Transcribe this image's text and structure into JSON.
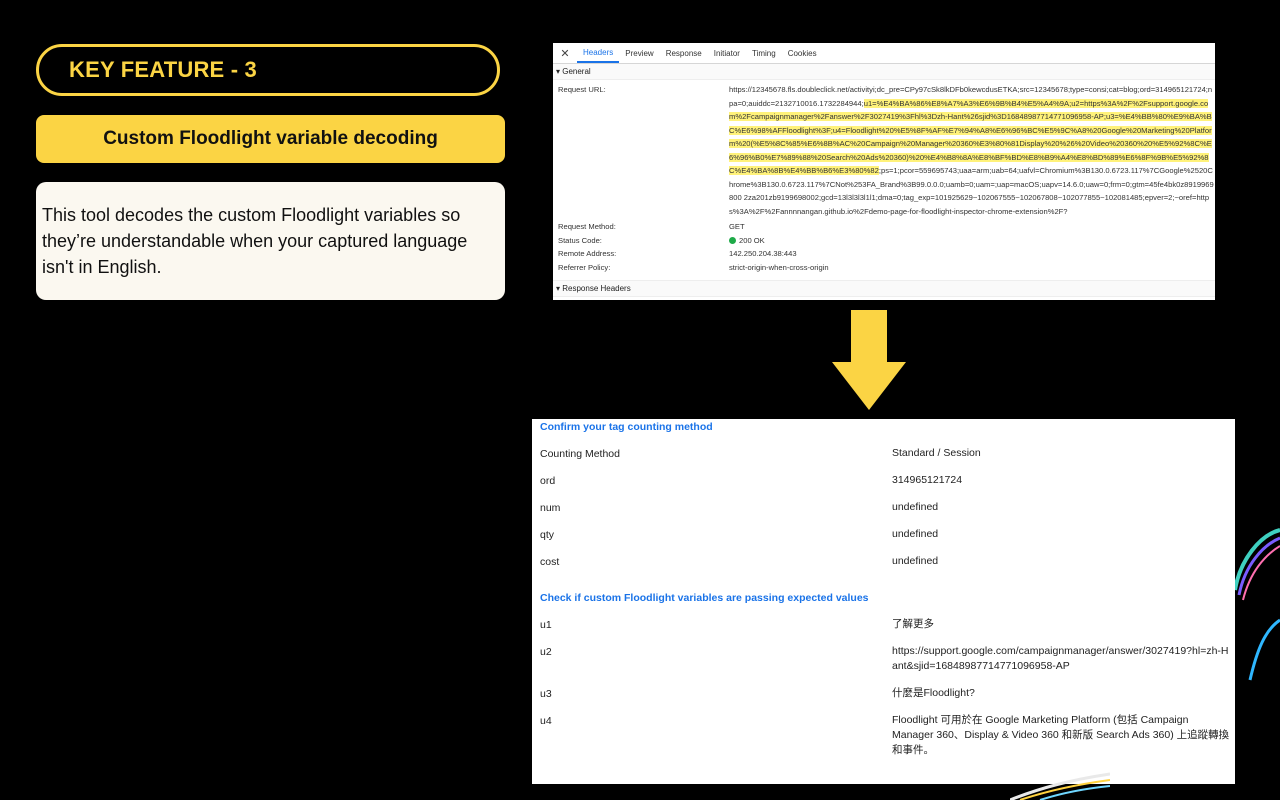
{
  "feature": {
    "badge": "KEY FEATURE - 3",
    "title": "Custom Floodlight variable decoding",
    "description": "This tool decodes the custom Floodlight variables so they’re understandable when your captured language isn't in English."
  },
  "devtools": {
    "close_icon": "close-icon",
    "tabs": [
      "Headers",
      "Preview",
      "Response",
      "Initiator",
      "Timing",
      "Cookies"
    ],
    "active_tab": "Headers",
    "section_general": "▾ General",
    "section_response": "▾ Response Headers",
    "request_url_label": "Request URL:",
    "request_url_plain_1": "https://12345678.fls.doubleclick.net/activityi;dc_pre=CPy97cSk8lkDFb0kewcdusETKA;src=12345678;type=consi;cat=blog;ord=314965121724;npa=0;auiddc=2132710016.1732284944;",
    "request_url_highlight": "u1=%E4%BA%86%E8%A7%A3%E6%9B%B4%E5%A4%9A;u2=https%3A%2F%2Fsupport.google.com%2Fcampaignmanager%2Fanswer%2F3027419%3Fhl%3Dzh-Hant%26sjid%3D16848987714771096958-AP;u3=%E4%BB%80%E9%BA%BC%E6%98%AFFloodlight%3F;u4=Floodlight%20%E5%8F%AF%E7%94%A8%E6%96%BC%E5%9C%A8%20Google%20Marketing%20Platform%20(%E5%8C%85%E6%8B%AC%20Campaign%20Manager%20360%E3%80%81Display%20%26%20Video%20360%20%E5%92%8C%E6%96%B0%E7%89%88%20Search%20Ads%20360)%20%E4%B8%8A%E8%BF%BD%E8%B9%A4%E8%BD%89%E6%8F%9B%E5%92%8C%E4%BA%8B%E4%BB%B6%E3%80%82",
    "request_url_plain_2": ";ps=1;pcor=559695743;uaa=arm;uab=64;uafvl=Chromium%3B130.0.6723.117%7CGoogle%2520Chrome%3B130.0.6723.117%7CNot%253FA_Brand%3B99.0.0.0;uamb=0;uam=;uap=macOS;uapv=14.6.0;uaw=0;frm=0;gtm=45fe4bk0z8919969800 2za201zb9199698002;gcd=13l3l3l3l1l1;dma=0;tag_exp=101925629~102067555~102067808~102077855~102081485;epver=2;~oref=https%3A%2F%2Fannnnangan.github.io%2Fdemo-page-for-floodlight-inspector-chrome-extension%2F?",
    "rows": [
      {
        "label": "Request Method:",
        "value": "GET"
      },
      {
        "label": "Status Code:",
        "value": "200 OK"
      },
      {
        "label": "Remote Address:",
        "value": "142.250.204.38:443"
      },
      {
        "label": "Referrer Policy:",
        "value": "strict-origin-when-cross-origin"
      }
    ],
    "status_color": "#1eaa48"
  },
  "arrow": {
    "icon": "down-arrow-icon",
    "color": "#fbd444"
  },
  "results": {
    "counting_heading": "Confirm your tag counting method",
    "counting_rows": [
      {
        "key": "Counting Method",
        "value": "Standard / Session"
      },
      {
        "key": "ord",
        "value": "314965121724"
      },
      {
        "key": "num",
        "value": "undefined"
      },
      {
        "key": "qty",
        "value": "undefined"
      },
      {
        "key": "cost",
        "value": "undefined"
      }
    ],
    "custom_heading": "Check if custom Floodlight variables are passing expected values",
    "custom_rows": [
      {
        "key": "u1",
        "value": "了解更多"
      },
      {
        "key": "u2",
        "value": "https://support.google.com/campaignmanager/answer/3027419?hl=zh-Hant&sjid=16848987714771096958-AP"
      },
      {
        "key": "u3",
        "value": "什麼是Floodlight?"
      },
      {
        "key": "u4",
        "value": "Floodlight 可用於在 Google Marketing Platform (包括 Campaign Manager 360、Display & Video 360 和新版 Search Ads 360) 上追蹤轉換和事件。"
      }
    ]
  },
  "colors": {
    "accent": "#fbd444",
    "link_blue": "#1a73e8",
    "card_bg": "#fbf8f0"
  }
}
